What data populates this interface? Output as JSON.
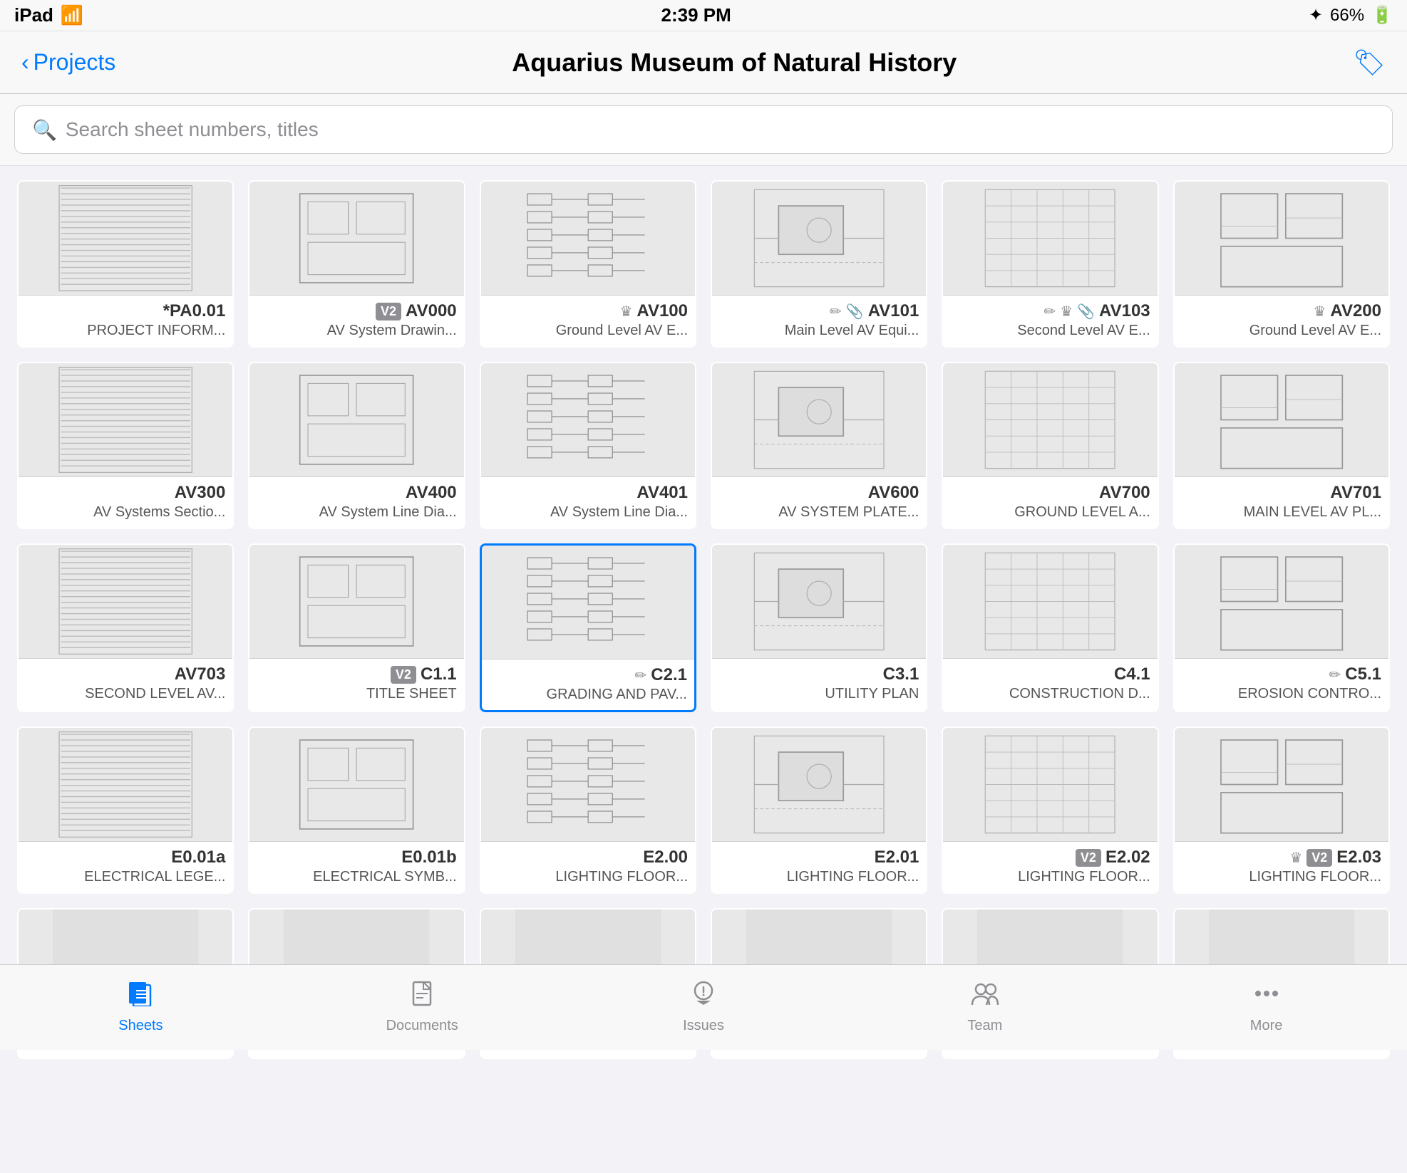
{
  "statusBar": {
    "device": "iPad",
    "wifi": "wifi",
    "time": "2:39 PM",
    "bluetooth": "bluetooth",
    "battery": "66%"
  },
  "navBar": {
    "backLabel": "Projects",
    "title": "Aquarius Museum of Natural History",
    "tagIcon": "🏷"
  },
  "searchBar": {
    "placeholder": "Search sheet numbers, titles"
  },
  "sheets": [
    {
      "id": "PA01",
      "number": "*PA0.01",
      "title": "PROJECT INFORM...",
      "badge": "",
      "icons": [],
      "selected": false
    },
    {
      "id": "AV000",
      "number": "AV000",
      "title": "AV System Drawin...",
      "badge": "V2",
      "icons": [],
      "selected": false
    },
    {
      "id": "AV100",
      "number": "AV100",
      "title": "Ground Level AV E...",
      "badge": "",
      "icons": [
        "crown"
      ],
      "selected": false
    },
    {
      "id": "AV101",
      "number": "AV101",
      "title": "Main Level AV Equi...",
      "badge": "",
      "icons": [
        "pen",
        "paperclip"
      ],
      "selected": false
    },
    {
      "id": "AV103",
      "number": "AV103",
      "title": "Second Level AV E...",
      "badge": "",
      "icons": [
        "pen",
        "crown",
        "paperclip"
      ],
      "selected": false
    },
    {
      "id": "AV200",
      "number": "AV200",
      "title": "Ground Level AV E...",
      "badge": "",
      "icons": [
        "crown"
      ],
      "selected": false
    },
    {
      "id": "AV300",
      "number": "AV300",
      "title": "AV Systems Sectio...",
      "badge": "",
      "icons": [],
      "selected": false
    },
    {
      "id": "AV400",
      "number": "AV400",
      "title": "AV System Line Dia...",
      "badge": "",
      "icons": [],
      "selected": false
    },
    {
      "id": "AV401",
      "number": "AV401",
      "title": "AV System Line Dia...",
      "badge": "",
      "icons": [],
      "selected": false
    },
    {
      "id": "AV600",
      "number": "AV600",
      "title": "AV SYSTEM PLATE...",
      "badge": "",
      "icons": [],
      "selected": false
    },
    {
      "id": "AV700",
      "number": "AV700",
      "title": "GROUND LEVEL A...",
      "badge": "",
      "icons": [],
      "selected": false
    },
    {
      "id": "AV701",
      "number": "AV701",
      "title": "MAIN LEVEL AV PL...",
      "badge": "",
      "icons": [],
      "selected": false
    },
    {
      "id": "AV703",
      "number": "AV703",
      "title": "SECOND LEVEL AV...",
      "badge": "",
      "icons": [],
      "selected": false
    },
    {
      "id": "C11",
      "number": "C1.1",
      "title": "TITLE SHEET",
      "badge": "V2",
      "icons": [],
      "selected": false
    },
    {
      "id": "C21",
      "number": "C2.1",
      "title": "GRADING AND PAV...",
      "badge": "",
      "icons": [
        "pen"
      ],
      "selected": true
    },
    {
      "id": "C31",
      "number": "C3.1",
      "title": "UTILITY PLAN",
      "badge": "",
      "icons": [],
      "selected": false
    },
    {
      "id": "C41",
      "number": "C4.1",
      "title": "CONSTRUCTION D...",
      "badge": "",
      "icons": [],
      "selected": false
    },
    {
      "id": "C51",
      "number": "C5.1",
      "title": "EROSION CONTRO...",
      "badge": "",
      "icons": [
        "pen"
      ],
      "selected": false
    },
    {
      "id": "E001a",
      "number": "E0.01a",
      "title": "ELECTRICAL LEGE...",
      "badge": "",
      "icons": [],
      "selected": false
    },
    {
      "id": "E001b",
      "number": "E0.01b",
      "title": "ELECTRICAL SYMB...",
      "badge": "",
      "icons": [],
      "selected": false
    },
    {
      "id": "E200",
      "number": "E2.00",
      "title": "LIGHTING FLOOR...",
      "badge": "",
      "icons": [],
      "selected": false
    },
    {
      "id": "E201",
      "number": "E2.01",
      "title": "LIGHTING FLOOR...",
      "badge": "",
      "icons": [],
      "selected": false
    },
    {
      "id": "E202",
      "number": "E2.02",
      "title": "LIGHTING FLOOR...",
      "badge": "V2",
      "icons": [],
      "selected": false
    },
    {
      "id": "E203",
      "number": "E2.03",
      "title": "LIGHTING FLOOR...",
      "badge": "V2",
      "icons": [
        "crown"
      ],
      "selected": false
    },
    {
      "id": "R1",
      "number": "",
      "title": "",
      "badge": "",
      "icons": [],
      "selected": false
    },
    {
      "id": "R2",
      "number": "",
      "title": "",
      "badge": "",
      "icons": [],
      "selected": false
    },
    {
      "id": "R3",
      "number": "",
      "title": "",
      "badge": "",
      "icons": [],
      "selected": false
    },
    {
      "id": "R4",
      "number": "",
      "title": "",
      "badge": "",
      "icons": [],
      "selected": false
    },
    {
      "id": "R5",
      "number": "",
      "title": "",
      "badge": "",
      "icons": [],
      "selected": false
    },
    {
      "id": "R6",
      "number": "",
      "title": "",
      "badge": "",
      "icons": [],
      "selected": false
    }
  ],
  "tabBar": {
    "tabs": [
      {
        "id": "sheets",
        "label": "Sheets",
        "icon": "sheets",
        "active": true
      },
      {
        "id": "documents",
        "label": "Documents",
        "icon": "documents",
        "active": false
      },
      {
        "id": "issues",
        "label": "Issues",
        "icon": "issues",
        "active": false
      },
      {
        "id": "team",
        "label": "Team",
        "icon": "team",
        "active": false
      },
      {
        "id": "more",
        "label": "More",
        "icon": "more",
        "active": false
      }
    ]
  }
}
